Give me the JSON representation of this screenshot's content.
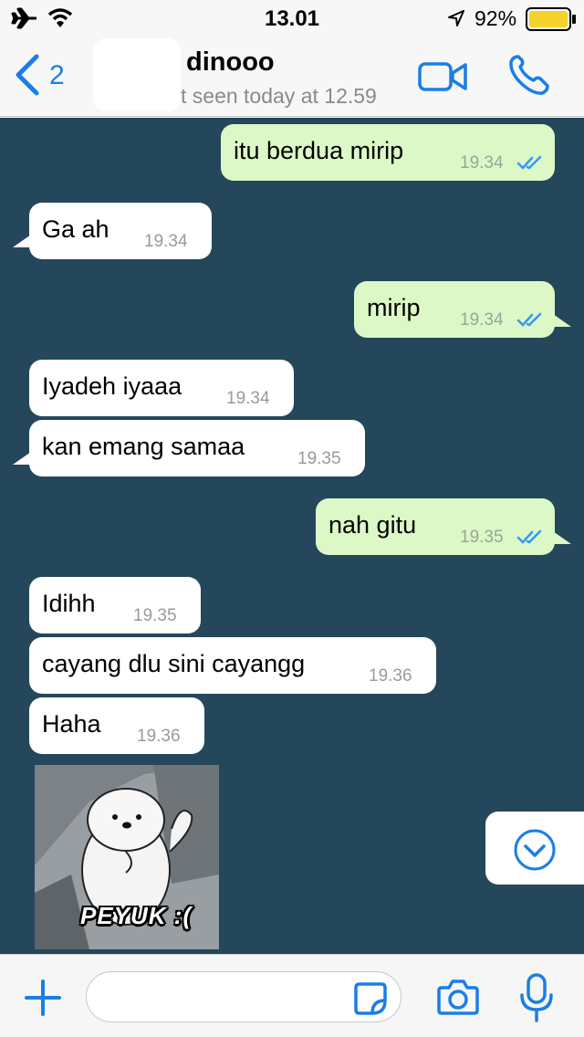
{
  "status_bar": {
    "time": "13.01",
    "battery": "92%"
  },
  "header": {
    "back_count": "2",
    "contact_name": "dinooo",
    "last_seen": "t seen today at 12.59"
  },
  "messages": [
    {
      "dir": "out",
      "text": "itu berdua mirip",
      "time": "19.34",
      "read": true
    },
    {
      "dir": "in",
      "text": "Ga ah",
      "time": "19.34"
    },
    {
      "dir": "out",
      "text": "mirip",
      "time": "19.34",
      "read": true
    },
    {
      "dir": "in",
      "text": "Iyadeh iyaaa",
      "time": "19.34"
    },
    {
      "dir": "in",
      "text": "kan emang samaa",
      "time": "19.35"
    },
    {
      "dir": "out",
      "text": "nah gitu",
      "time": "19.35",
      "read": true
    },
    {
      "dir": "in",
      "text": "Idihh",
      "time": "19.35"
    },
    {
      "dir": "in",
      "text": "cayang dlu sini cayangg",
      "time": "19.36"
    },
    {
      "dir": "in",
      "text": "Haha",
      "time": "19.36"
    }
  ],
  "sticker": {
    "caption": "PEYUK :("
  },
  "composer": {
    "value": ""
  },
  "colors": {
    "accent": "#1a7ee6",
    "chat_background": "#24475b",
    "outgoing_bubble": "#dcf8c6",
    "incoming_bubble": "#ffffff",
    "read_ticks": "#3497f9",
    "battery": "#f5d22c"
  },
  "icons": [
    "airplane-icon",
    "wifi-icon",
    "location-arrow-icon",
    "battery-icon",
    "back-chevron-icon",
    "video-call-icon",
    "phone-icon",
    "double-check-icon",
    "chevron-down-circle-icon",
    "plus-icon",
    "sticker-icon",
    "camera-icon",
    "microphone-icon"
  ]
}
